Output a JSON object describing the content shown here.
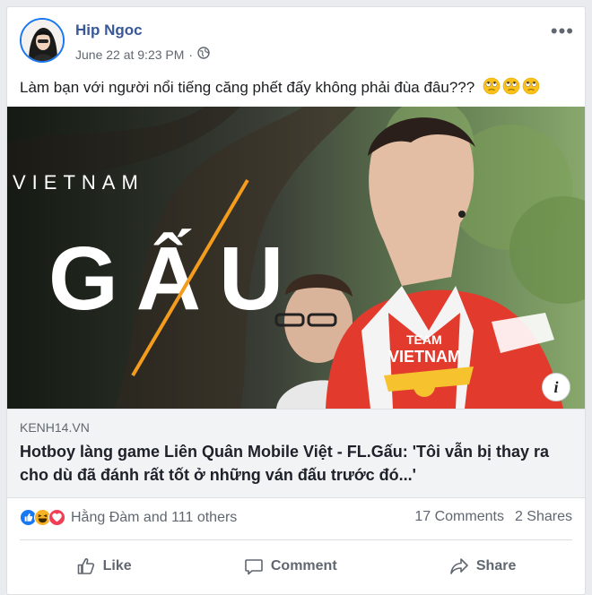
{
  "post": {
    "author": "Hip Ngoc",
    "timestamp": "June 22 at 9:23 PM",
    "privacy_separator": "·",
    "privacy_icon": "globe-icon",
    "more_label": "•••",
    "text": "Làm bạn với người nổi tiếng căng phết đấy không phải đùa đâu???",
    "emojis": [
      "rolling-eyes-emoji",
      "rolling-eyes-emoji",
      "rolling-eyes-emoji"
    ]
  },
  "media": {
    "overlay_top": "VIETNAM",
    "overlay_main": "GẤU",
    "jersey_line1": "TEAM",
    "jersey_line2": "VIETNAM",
    "info_label": "i"
  },
  "link": {
    "domain": "KENH14.VN",
    "headline": "Hotboy làng game Liên Quân Mobile Việt - FL.Gấu: 'Tôi vẫn bị thay ra cho dù đã đánh rất tốt ở những ván đấu trước đó...'"
  },
  "engagement": {
    "reaction_icons": [
      "like-reaction-icon",
      "haha-reaction-icon",
      "love-reaction-icon"
    ],
    "reactors": "Hằng Đàm and 111 others",
    "comments": "17 Comments",
    "shares": "2 Shares"
  },
  "actions": {
    "like": "Like",
    "comment": "Comment",
    "share": "Share"
  },
  "colors": {
    "author_link": "#385898",
    "like_blue": "#1877f2",
    "love_red": "#f33e58",
    "haha_yellow": "#f7b125",
    "stripe_orange": "#f39c1e",
    "jersey_red": "#e23b2e"
  }
}
